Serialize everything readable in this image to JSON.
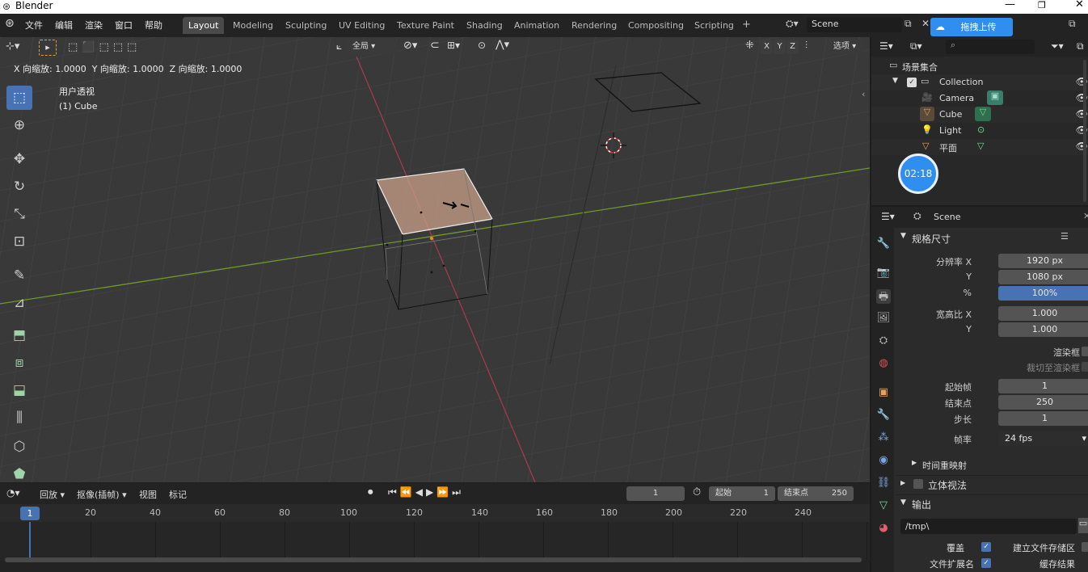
{
  "title_bar": {
    "app_title": "Blender"
  },
  "menus": [
    "文件",
    "编辑",
    "渲染",
    "窗口",
    "帮助"
  ],
  "workspaces": [
    "Layout",
    "Modeling",
    "Sculpting",
    "UV Editing",
    "Texture Paint",
    "Shading",
    "Animation",
    "Rendering",
    "Compositing",
    "Scripting"
  ],
  "active_workspace": "Layout",
  "scene_name": "Scene",
  "upload_button": "拖拽上传",
  "timer": "02:18",
  "viewport": {
    "scale_readout": "X 向缩放: 1.0000  Y 向缩放: 1.0000  Z 向缩放: 1.0000",
    "view_name": "用户透视",
    "object_name": "(1) Cube",
    "orientation": "全局",
    "axis_x": "X",
    "axis_y": "Y",
    "axis_z": "Z",
    "options": "选项"
  },
  "outliner": {
    "root": "场景集合",
    "collection": "Collection",
    "items": [
      "Camera",
      "Cube",
      "Light",
      "平面"
    ]
  },
  "properties": {
    "header": "Scene",
    "panel_format": "规格尺寸",
    "res_x_label": "分辨率 X",
    "res_x": "1920 px",
    "res_y_label": "Y",
    "res_y": "1080 px",
    "res_pct_label": "%",
    "res_pct": "100%",
    "aspect_x_label": "宽高比 X",
    "aspect_x": "1.000",
    "aspect_y_label": "Y",
    "aspect_y": "1.000",
    "render_region": "渲染框",
    "crop_region": "裁切至渲染框",
    "frame_start_label": "起始帧",
    "frame_start": "1",
    "frame_end_label": "结束点",
    "frame_end": "250",
    "frame_step_label": "步长",
    "frame_step": "1",
    "fps_label": "帧率",
    "fps": "24 fps",
    "time_remap": "时间重映射",
    "stereo": "立体视法",
    "output": "输出",
    "output_path": "/tmp\\",
    "overwrite": "覆盖",
    "placeholders": "建立文件存储区",
    "file_ext": "文件扩展名",
    "cache_result": "缓存结果"
  },
  "timeline": {
    "playback": "回放",
    "keying": "抠像(插帧)",
    "view": "视图",
    "marker": "标记",
    "current_frame": "1",
    "start_label": "起始",
    "start": "1",
    "end_label": "结束点",
    "end": "250",
    "ticks": [
      "20",
      "40",
      "60",
      "80",
      "100",
      "120",
      "140",
      "160",
      "180",
      "200",
      "220",
      "240"
    ],
    "cursor_frame": "1"
  },
  "colors": {
    "accent": "#4772b3",
    "x_axis": "#a33b4b",
    "y_axis": "#6f9a2b",
    "active_tab": "#4a4a4a"
  }
}
